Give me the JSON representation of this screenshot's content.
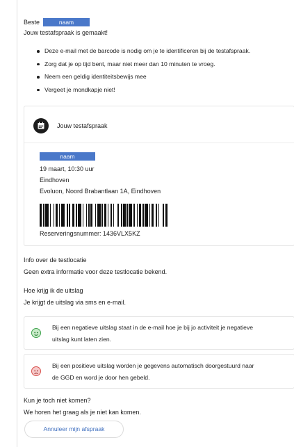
{
  "greeting": {
    "salutation": "Beste",
    "name": "naam"
  },
  "confirmation": "Jouw testafspraak is gemaakt!",
  "bullets": [
    "Deze e-mail met de barcode is nodig om je te identificeren bij de testafspraak.",
    "Zorg dat je op tijd bent, maar niet meer dan 10 minuten te vroeg.",
    "Neem een geldig identiteitsbewijs mee",
    "Vergeet je mondkapje niet!"
  ],
  "appointment": {
    "heading": "Jouw testafspraak",
    "name": "naam",
    "datetime": "19 maart, 10:30 uur",
    "city": "Eindhoven",
    "address": "Evoluon, Noord Brabantlaan 1A, Eindhoven",
    "reservation": "Reserveringsnummer: 1436VLX5KZ"
  },
  "location_info": {
    "title": "Info over de testlocatie",
    "text": "Geen extra informatie voor deze testlocatie bekend."
  },
  "result_info": {
    "title": "Hoe krijg ik de uitslag",
    "text": "Je krijgt de uitslag via sms en e-mail."
  },
  "negative_box": {
    "line1": "Bij een negatieve uitslag staat in de e-mail hoe je bij jo activiteit je negatieve",
    "line2": "uitslag kunt laten zien.",
    "icon": "smile-icon",
    "color": "#3fa34d"
  },
  "positive_box": {
    "line1": "Bij een positieve uitslag worden je gegevens automatisch doorgestuurd naar",
    "line2": "de GGD en word je door hen gebeld.",
    "icon": "sad-icon",
    "color": "#d9534f"
  },
  "cannot_come": {
    "title": "Kun je toch niet komen?",
    "text": "We horen het graag als je niet kan komen.",
    "button": "Annuleer mijn afspraak"
  },
  "colors": {
    "name_highlight": "#4a78c9",
    "link": "#3f6fbf"
  }
}
